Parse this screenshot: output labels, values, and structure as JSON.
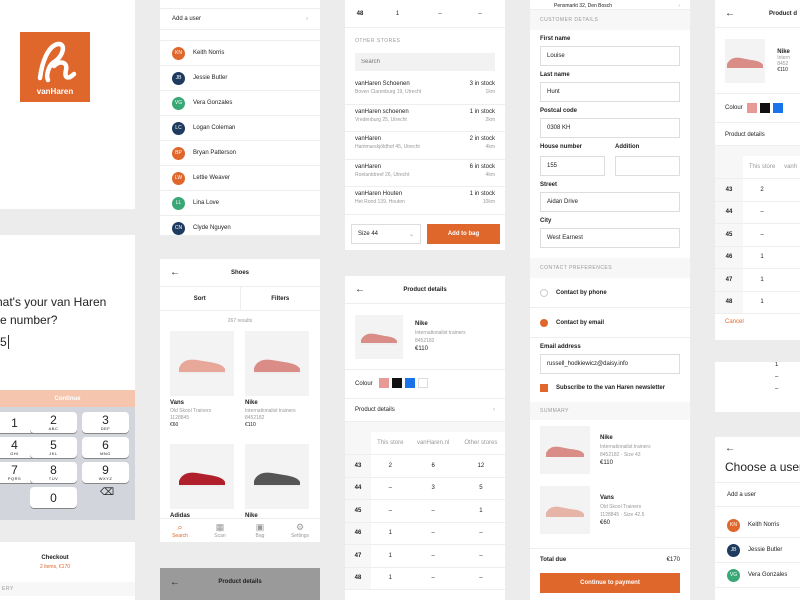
{
  "brand": {
    "name": "vanHaren",
    "color": "#e0672c"
  },
  "store_prompt": {
    "line1": "hat's your van Haren",
    "line2": "re number?",
    "value": "5",
    "continue": "Continue"
  },
  "keypad": [
    {
      "d": "1",
      "l": ""
    },
    {
      "d": "2",
      "l": "ABC"
    },
    {
      "d": "3",
      "l": "DEF"
    },
    {
      "d": "4",
      "l": "GHI"
    },
    {
      "d": "5",
      "l": "JKL"
    },
    {
      "d": "6",
      "l": "MNO"
    },
    {
      "d": "7",
      "l": "PQRS"
    },
    {
      "d": "8",
      "l": "TUV"
    },
    {
      "d": "9",
      "l": "WXYZ"
    },
    {
      "d": "0",
      "l": ""
    }
  ],
  "keypad_extra": {
    "plus": "+ ✱ #"
  },
  "checkout_bar": {
    "title": "Checkout",
    "subtitle": "2 items, €170",
    "section": "ERY"
  },
  "users": {
    "add_label": "Add a user",
    "list": [
      {
        "initials": "KN",
        "name": "Keith Norris",
        "color": "#e0672c"
      },
      {
        "initials": "JB",
        "name": "Jessie Butler",
        "color": "#1f3a5f"
      },
      {
        "initials": "VG",
        "name": "Vera Gonzales",
        "color": "#3aa876"
      },
      {
        "initials": "LC",
        "name": "Logan Coleman",
        "color": "#1f3a5f"
      },
      {
        "initials": "BP",
        "name": "Bryan Patterson",
        "color": "#e0672c"
      },
      {
        "initials": "LW",
        "name": "Lettie Weaver",
        "color": "#e0672c"
      },
      {
        "initials": "LL",
        "name": "Lina Love",
        "color": "#3aa876"
      },
      {
        "initials": "CN",
        "name": "Clyde Nguyen",
        "color": "#1f3a5f"
      }
    ]
  },
  "shoes": {
    "title": "Shoes",
    "sort": "Sort",
    "filters": "Filters",
    "results": "267 results",
    "items": [
      {
        "brand": "Vans",
        "model": "Old Skool Trainers",
        "sku": "1128845 ",
        "price": "€60"
      },
      {
        "brand": "Nike",
        "model": "Internationalist trainers",
        "sku": "8452182",
        "price": "€110"
      },
      {
        "brand": "Adidas",
        "model": "",
        "sku": "",
        "price": ""
      },
      {
        "brand": "Nike",
        "model": "",
        "sku": "",
        "price": ""
      }
    ],
    "nav": [
      "Search",
      "Scan",
      "Bag",
      "Settings"
    ]
  },
  "bottom_header": {
    "title": "Product details"
  },
  "stores": {
    "top_row": {
      "size": "48",
      "a": "1",
      "b": "–",
      "c": "–"
    },
    "section": "OTHER STORES",
    "search_placeholder": "Search",
    "list": [
      {
        "name": "vanHaren Schoenen",
        "addr": "Boven Clarenburg 19, Utrecht",
        "stock": "3 in stock",
        "dist": "1km"
      },
      {
        "name": "vanHaren schoenen",
        "addr": "Vredenburg 25, Utrecht",
        "stock": "1 in stock",
        "dist": "2km"
      },
      {
        "name": "vanHaren",
        "addr": "Hammarskjöldhof 45, Utrecht",
        "stock": "2 in stock",
        "dist": "4km"
      },
      {
        "name": "vanHaren",
        "addr": "Roelantdreef 26, Utrecht",
        "stock": "6 in stock",
        "dist": "4km"
      },
      {
        "name": "vanHaren Houten",
        "addr": "Het Rond 139, Houten",
        "stock": "1 in stock",
        "dist": "10km"
      }
    ],
    "size_select": "Size 44",
    "add_to_bag": "Add to bag"
  },
  "product": {
    "title": "Product details",
    "brand": "Nike",
    "model": "Internationalist trainers",
    "sku": "8452182",
    "price": "€110",
    "colour_label": "Colour",
    "colours": [
      "#e79a96",
      "#111111",
      "#1a73e8",
      "#ffffff"
    ],
    "details": "Product details",
    "cols": [
      "This store",
      "vanHaren.nl",
      "Other stores"
    ],
    "rows": [
      {
        "size": "43",
        "a": "2",
        "b": "6",
        "c": "12"
      },
      {
        "size": "44",
        "a": "–",
        "b": "3",
        "c": "5"
      },
      {
        "size": "45",
        "a": "–",
        "b": "–",
        "c": "1"
      },
      {
        "size": "46",
        "a": "1",
        "b": "–",
        "c": "–"
      },
      {
        "size": "47",
        "a": "1",
        "b": "–",
        "c": "–"
      },
      {
        "size": "48",
        "a": "1",
        "b": "–",
        "c": "–"
      }
    ]
  },
  "checkout": {
    "top_addr": "Pensmarkt 32, Den Bosch",
    "section_details": "CUSTOMER DETAILS",
    "first_name": {
      "label": "First name",
      "value": "Louise"
    },
    "last_name": {
      "label": "Last name",
      "value": "Hunt"
    },
    "postal": {
      "label": "Postcal code",
      "value": "0308 KH"
    },
    "house": {
      "label": "House number",
      "value": "155"
    },
    "addition": {
      "label": "Addition",
      "value": ""
    },
    "street": {
      "label": "Street",
      "value": "Aidan Drive"
    },
    "city": {
      "label": "City",
      "value": "West Earnest"
    },
    "section_contact": "CONTACT PREFERENCES",
    "phone": "Contact by phone",
    "email_opt": "Contact by email",
    "email": {
      "label": "Email address",
      "value": "russell_hodkiewicz@daisy.info"
    },
    "newsletter": "Subscribe to the van Haren newsletter",
    "section_summary": "SUMMARY",
    "items": [
      {
        "brand": "Nike",
        "model": "Internationalist trainers",
        "meta": "8452182 · Size 43",
        "price": "€110"
      },
      {
        "brand": "Vans",
        "model": "Old Skool Trainers",
        "meta": "1128845 · Size 42.5",
        "price": "€60"
      }
    ],
    "total_label": "Total due",
    "total": "€170",
    "pay": "Continue to payment"
  },
  "right_product": {
    "title": "Product d",
    "brand": "Nike",
    "model": "Intern",
    "sku": "8452",
    "price": "€110",
    "colour": "Colour",
    "details": "Product details",
    "col": "This store",
    "col2": "vanh",
    "rows": [
      {
        "size": "43",
        "a": "2"
      },
      {
        "size": "44",
        "a": "–"
      },
      {
        "size": "45",
        "a": "–"
      },
      {
        "size": "46",
        "a": "1"
      },
      {
        "size": "47",
        "a": "1"
      },
      {
        "size": "48",
        "a": "1"
      }
    ],
    "cancel": "Cancel",
    "extra": [
      "1",
      "–",
      "–"
    ]
  },
  "right_users": {
    "title": "Choose a user",
    "add": "Add a user",
    "list": [
      {
        "initials": "KN",
        "name": "Keith Norris",
        "color": "#e0672c"
      },
      {
        "initials": "JB",
        "name": "Jessie Butler",
        "color": "#1f3a5f"
      },
      {
        "initials": "VG",
        "name": "Vera Gonzales",
        "color": "#3aa876"
      }
    ]
  }
}
